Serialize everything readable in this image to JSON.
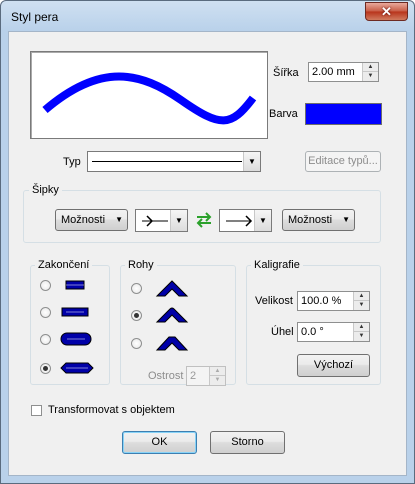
{
  "window": {
    "title": "Styl pera",
    "close_glyph": "✕"
  },
  "preview": {
    "stroke_color": "#0000ff"
  },
  "width": {
    "label": "Šířka",
    "value": "2.00 mm"
  },
  "color": {
    "label": "Barva",
    "value": "#0000ff"
  },
  "type": {
    "label": "Typ",
    "edit_button": "Editace typů..."
  },
  "arrows": {
    "group_title": "Šipky",
    "left_options": "Možnosti",
    "right_options": "Možnosti",
    "swap_icon": "swap-arrows-icon"
  },
  "endings": {
    "group_title": "Zakončení",
    "selected_index": 3
  },
  "corners": {
    "group_title": "Rohy",
    "selected_index": 1,
    "sharpness_label": "Ostrost",
    "sharpness_value": "2"
  },
  "calligraphy": {
    "group_title": "Kaligrafie",
    "size_label": "Velikost",
    "size_value": "100.0 %",
    "angle_label": "Úhel",
    "angle_value": "0.0 °",
    "default_button": "Výchozí"
  },
  "transform": {
    "label": "Transformovat s objektem",
    "checked": false
  },
  "buttons": {
    "ok": "OK",
    "cancel": "Storno"
  }
}
